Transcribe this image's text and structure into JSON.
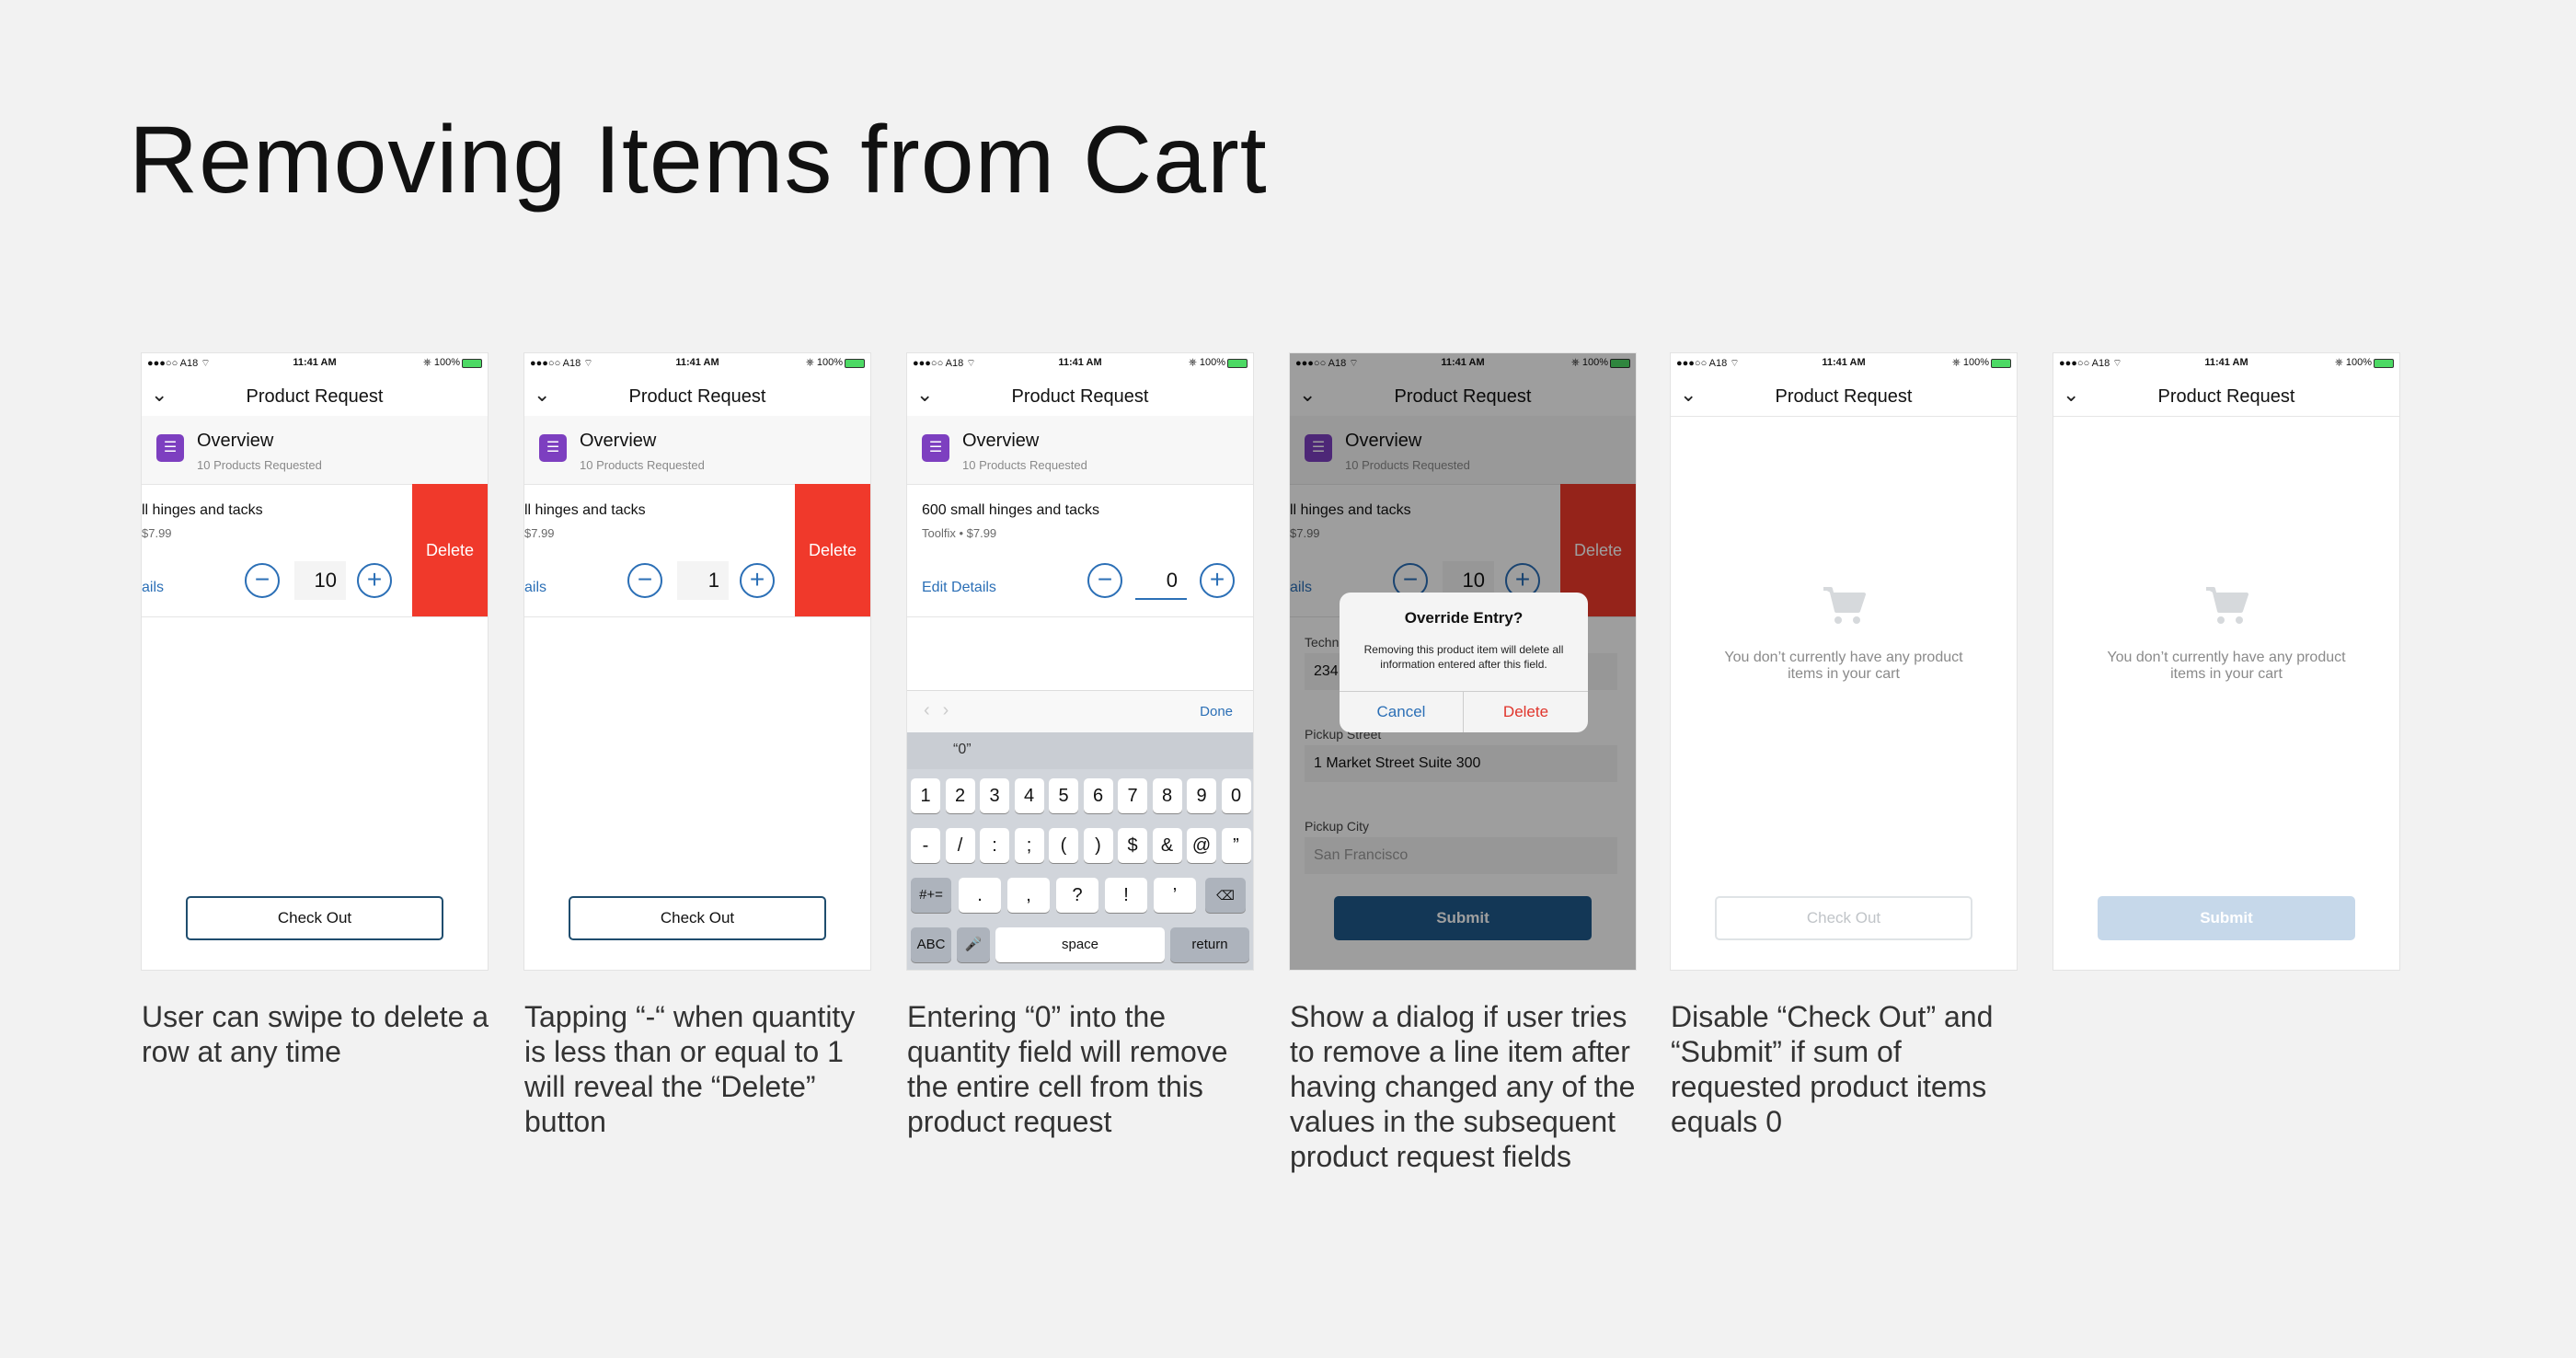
{
  "page": {
    "title": "Removing Items from Cart"
  },
  "status": {
    "carrier": "●●●○○ A18 ⌔",
    "time": "11:41 AM",
    "battery": "⎈ 100%"
  },
  "nav": {
    "title": "Product Request"
  },
  "overview": {
    "title": "Overview",
    "subtitle": "10 Products Requested"
  },
  "item": {
    "name_full": "600 small hinges and tacks",
    "name_cut": "ll hinges and tacks",
    "meta_full": "Toolfix • $7.99",
    "meta_cut": "$7.99",
    "edit_full": "Edit Details",
    "edit_cut": "ails"
  },
  "screens": [
    {
      "qty": "10",
      "delete_label": "Delete",
      "checkout_label": "Check Out",
      "caption": "User can swipe to delete a row at any time"
    },
    {
      "qty": "1",
      "delete_label": "Delete",
      "checkout_label": "Check Out",
      "caption": "Tapping “-“ when quantity is less than or equal to 1 will reveal the “Delete” button"
    },
    {
      "qty": "0",
      "done_label": "Done",
      "suggestion": "“0”",
      "caption": "Entering “0” into the quantity field will remove the entire cell from this product request"
    },
    {
      "qty": "10",
      "delete_label": "Delete",
      "tech_label": "Techn",
      "tech_value": "234",
      "pickup_street_label": "Pickup Street",
      "pickup_street_value": "1 Market Street Suite 300",
      "pickup_city_label": "Pickup City",
      "pickup_city_placeholder": "San Francisco",
      "submit_label": "Submit",
      "dialog": {
        "title": "Override Entry?",
        "message": "Removing this product item will delete all information entered after this field.",
        "cancel": "Cancel",
        "delete": "Delete"
      },
      "caption": "Show a dialog if user tries to remove a line item after having changed any of the values in the subsequent product request fields"
    },
    {
      "empty_message": "You don’t currently have any product items in your cart",
      "checkout_label": "Check Out",
      "caption": "Disable “Check Out” and “Submit” if sum of requested product items equals 0"
    },
    {
      "empty_message": "You don’t currently have any product items in your cart",
      "submit_label": "Submit"
    }
  ],
  "keyboard": {
    "row1": [
      "1",
      "2",
      "3",
      "4",
      "5",
      "6",
      "7",
      "8",
      "9",
      "0"
    ],
    "row2": [
      "-",
      "/",
      ":",
      ";",
      "(",
      ")",
      "$",
      "&",
      "@",
      "”"
    ],
    "row3": [
      "#+=",
      ".",
      ",",
      "?",
      "!",
      "’",
      "⌫"
    ],
    "row4": [
      "ABC",
      "🎤",
      "space",
      "return"
    ]
  },
  "colors": {
    "accent": "#2b6fb6",
    "delete": "#f0392b",
    "brand_purple": "#7d3fc0",
    "primary_button": "#1f5a8c"
  },
  "icons": [
    "chevron-down-icon",
    "overview-icon",
    "minus-icon",
    "plus-icon",
    "cart-icon",
    "backspace-icon",
    "microphone-icon"
  ]
}
